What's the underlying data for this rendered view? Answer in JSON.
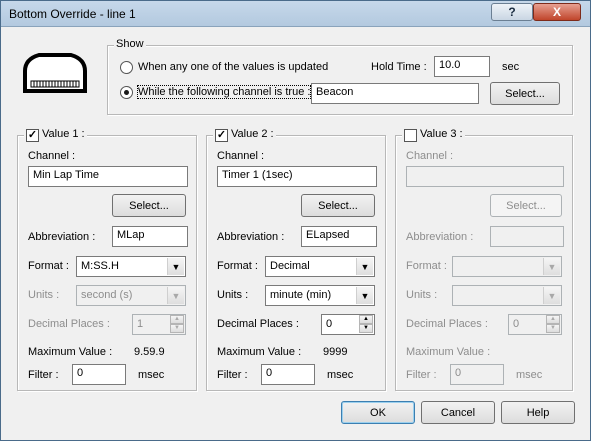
{
  "window": {
    "title": "Bottom Override - line 1",
    "help_glyph": "?",
    "close_glyph": "X"
  },
  "show": {
    "legend": "Show",
    "option_updated": "When any one of the values is updated",
    "option_channel": "While the following channel is true :",
    "hold_time_label": "Hold Time :",
    "hold_time_value": "10.0",
    "hold_time_unit": "sec",
    "channel_value": "Beacon",
    "select_label": "Select..."
  },
  "values": [
    {
      "legend": "Value 1 :",
      "checked": true,
      "channel_label": "Channel :",
      "channel_value": "Min Lap Time",
      "select_label": "Select...",
      "abbrev_label": "Abbreviation :",
      "abbrev_value": "MLap",
      "format_label": "Format :",
      "format_value": "M:SS.H",
      "units_label": "Units :",
      "units_value": "second (s)",
      "decimal_label": "Decimal Places :",
      "decimal_value": "1",
      "max_label": "Maximum Value :",
      "max_value": "9.59.9",
      "filter_label": "Filter :",
      "filter_value": "0",
      "filter_unit": "msec"
    },
    {
      "legend": "Value 2 :",
      "checked": true,
      "channel_label": "Channel :",
      "channel_value": "Timer 1 (1sec)",
      "select_label": "Select...",
      "abbrev_label": "Abbreviation :",
      "abbrev_value": "ELapsed",
      "format_label": "Format :",
      "format_value": "Decimal",
      "units_label": "Units :",
      "units_value": "minute (min)",
      "decimal_label": "Decimal Places :",
      "decimal_value": "0",
      "max_label": "Maximum Value :",
      "max_value": "9999",
      "filter_label": "Filter :",
      "filter_value": "0",
      "filter_unit": "msec"
    },
    {
      "legend": "Value 3 :",
      "checked": false,
      "channel_label": "Channel :",
      "channel_value": "",
      "select_label": "Select...",
      "abbrev_label": "Abbreviation :",
      "abbrev_value": "",
      "format_label": "Format :",
      "format_value": "",
      "units_label": "Units :",
      "units_value": "",
      "decimal_label": "Decimal Places :",
      "decimal_value": "0",
      "max_label": "Maximum Value :",
      "max_value": "",
      "filter_label": "Filter :",
      "filter_value": "0",
      "filter_unit": "msec"
    }
  ],
  "footer": {
    "ok_label": "OK",
    "cancel_label": "Cancel",
    "help_label": "Help"
  },
  "icons": {
    "dropdown": "▼",
    "spin_up": "▲",
    "spin_down": "▼",
    "check": "✓"
  }
}
